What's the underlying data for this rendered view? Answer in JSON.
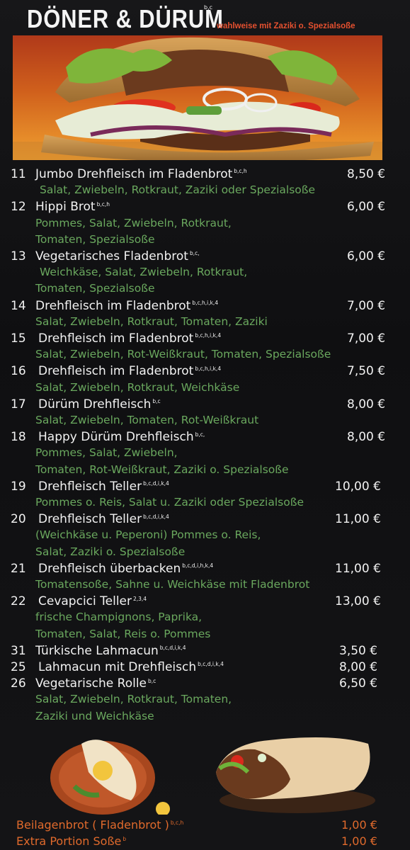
{
  "header": {
    "title": "DÖNER & DÜRUM",
    "title_sup": "b,c",
    "subtitle": "wahlweise mit Zaziki o. Spezialsoße"
  },
  "items": [
    {
      "num": "11",
      "name": "Jumbo Drehfleisch im Fladenbrot",
      "sup": "b,c,h",
      "price": "8,50 €",
      "desc": [
        "Salat, Zwiebeln, Rotkraut, Zaziki oder Spezialsoße"
      ]
    },
    {
      "num": "12",
      "name": "Hippi Brot",
      "sup": "b,c,h",
      "price": "6,00 €",
      "desc": [
        "Pommes, Salat, Zwiebeln, Rotkraut,",
        "Tomaten, Spezialsoße"
      ]
    },
    {
      "num": "13",
      "name": "Vegetarisches Fladenbrot",
      "sup": "b,c,",
      "price": "6,00 €",
      "desc": [
        "Weichkäse, Salat, Zwiebeln, Rotkraut,",
        "Tomaten, Spezialsoße"
      ]
    },
    {
      "num": "14",
      "name": "Drehfleisch im Fladenbrot",
      "sup": "b,c,h,i,k,4",
      "price": "7,00 €",
      "desc": [
        "Salat, Zwiebeln, Rotkraut, Tomaten, Zaziki"
      ]
    },
    {
      "num": "15",
      "name": "Drehfleisch im Fladenbrot",
      "sup": "b,c,h,i,k,4",
      "price": "7,00 €",
      "desc": [
        "Salat, Zwiebeln, Rot-Weißkraut, Tomaten, Spezialsoße"
      ]
    },
    {
      "num": "16",
      "name": "Drehfleisch im Fladenbrot",
      "sup": "b,c,h,i,k,4",
      "price": "7,50 €",
      "desc": [
        "Salat, Zwiebeln, Rotkraut,  Weichkäse"
      ]
    },
    {
      "num": "17",
      "name": "Dürüm Drehfleisch",
      "sup": "b,c",
      "price": "8,00 €",
      "desc": [
        "Salat, Zwiebeln, Tomaten, Rot-Weißkraut"
      ]
    },
    {
      "num": "18",
      "name": "Happy Dürüm Drehfleisch",
      "sup": "b,c,",
      "price": "8,00 €",
      "desc": [
        "Pommes, Salat, Zwiebeln,",
        "Tomaten, Rot-Weißkraut, Zaziki o. Spezialsoße"
      ]
    },
    {
      "num": "19",
      "name": "Drehfleisch Teller",
      "sup": "b,c,d,i,k,4",
      "price": "10,00 €",
      "desc": [
        "Pommes o. Reis, Salat u. Zaziki oder Spezialsoße"
      ]
    },
    {
      "num": "20",
      "name": "Drehfleisch Teller",
      "sup": "b,c,d,i,k,4",
      "price": "11,00 €",
      "desc": [
        "(Weichkäse u. Peperoni) Pommes o. Reis,",
        "Salat, Zaziki o. Spezialsoße"
      ]
    },
    {
      "num": "21",
      "name": "Drehfleisch überbacken",
      "sup": "b,c,d,i,h,k,4",
      "price": "11,00 €",
      "desc": [
        "Tomatensoße, Sahne u. Weichkäse mit Fladenbrot"
      ]
    },
    {
      "num": "22",
      "name": "Cevapcici Teller",
      "sup": "2,3,4",
      "price": "13,00 €",
      "desc": [
        "frische Champignons, Paprika,",
        "Tomaten, Salat, Reis o. Pommes"
      ]
    },
    {
      "num": "31",
      "name": "Türkische Lahmacun",
      "sup": "b,c,d,i,k,4",
      "price": "3,50 €",
      "desc": []
    },
    {
      "num": "25",
      "name": "Lahmacun mit Drehfleisch",
      "sup": "b,c,d,i,k,4",
      "price": "8,00 €",
      "desc": []
    },
    {
      "num": "26",
      "name": "Vegetarische Rolle",
      "sup": "b,c",
      "price": "6,50 €",
      "desc": [
        "Salat, Zwiebeln, Rotkraut, Tomaten,",
        "Zaziki und Weichkäse"
      ]
    }
  ],
  "extras": [
    {
      "name": "Beilagenbrot ( Fladenbrot )",
      "sup": "b,c,h",
      "price": "1,00 €"
    },
    {
      "name": "Extra Portion Soße",
      "sup": "b",
      "price": "1,00 €"
    }
  ],
  "colors": {
    "text": "#f2f2f2",
    "desc": "#6aa85e",
    "accent": "#e5502f",
    "extras": "#e06a2c"
  }
}
